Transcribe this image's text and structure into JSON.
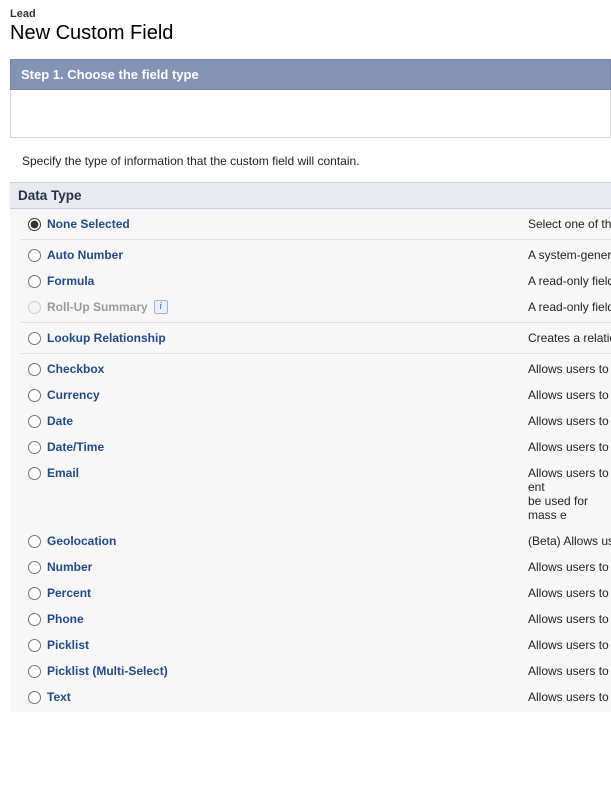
{
  "header": {
    "breadcrumb": "Lead",
    "title": "New Custom Field"
  },
  "step": {
    "label": "Step 1. Choose the field type"
  },
  "instructions": "Specify the type of information that the custom field will contain.",
  "section_title": "Data Type",
  "groups": [
    {
      "sep_before": false,
      "rows": [
        {
          "id": "none",
          "label": "None Selected",
          "selected": true,
          "disabled": false,
          "info": false,
          "desc": "Select one of the da"
        }
      ]
    },
    {
      "sep_before": true,
      "rows": [
        {
          "id": "autonum",
          "label": "Auto Number",
          "selected": false,
          "disabled": false,
          "info": false,
          "desc": "A system-generate"
        },
        {
          "id": "formula",
          "label": "Formula",
          "selected": false,
          "disabled": false,
          "info": false,
          "desc": "A read-only field tha"
        },
        {
          "id": "rollup",
          "label": "Roll-Up Summary",
          "selected": false,
          "disabled": true,
          "info": true,
          "desc": "A read-only field tha"
        }
      ]
    },
    {
      "sep_before": true,
      "rows": [
        {
          "id": "lookup",
          "label": "Lookup Relationship",
          "selected": false,
          "disabled": false,
          "info": false,
          "desc": "Creates a relationsh"
        }
      ]
    },
    {
      "sep_before": true,
      "rows": [
        {
          "id": "checkbox",
          "label": "Checkbox",
          "selected": false,
          "disabled": false,
          "info": false,
          "desc": "Allows users to sel"
        },
        {
          "id": "currency",
          "label": "Currency",
          "selected": false,
          "disabled": false,
          "info": false,
          "desc": "Allows users to ent"
        },
        {
          "id": "date",
          "label": "Date",
          "selected": false,
          "disabled": false,
          "info": false,
          "desc": "Allows users to ent"
        },
        {
          "id": "datetime",
          "label": "Date/Time",
          "selected": false,
          "disabled": false,
          "info": false,
          "desc": "Allows users to ent"
        },
        {
          "id": "email",
          "label": "Email",
          "selected": false,
          "disabled": false,
          "info": false,
          "desc": "Allows users to ent",
          "desc2": "be used for mass e"
        },
        {
          "id": "geo",
          "label": "Geolocation",
          "selected": false,
          "disabled": false,
          "info": false,
          "desc": "(Beta) Allows users"
        },
        {
          "id": "number",
          "label": "Number",
          "selected": false,
          "disabled": false,
          "info": false,
          "desc": "Allows users to ent"
        },
        {
          "id": "percent",
          "label": "Percent",
          "selected": false,
          "disabled": false,
          "info": false,
          "desc": "Allows users to ent"
        },
        {
          "id": "phone",
          "label": "Phone",
          "selected": false,
          "disabled": false,
          "info": false,
          "desc": "Allows users to ent"
        },
        {
          "id": "picklist",
          "label": "Picklist",
          "selected": false,
          "disabled": false,
          "info": false,
          "desc": "Allows users to sel"
        },
        {
          "id": "picklistm",
          "label": "Picklist (Multi-Select)",
          "selected": false,
          "disabled": false,
          "info": false,
          "desc": "Allows users to sel"
        },
        {
          "id": "text",
          "label": "Text",
          "selected": false,
          "disabled": false,
          "info": false,
          "desc": "Allows users to ent"
        }
      ]
    }
  ]
}
